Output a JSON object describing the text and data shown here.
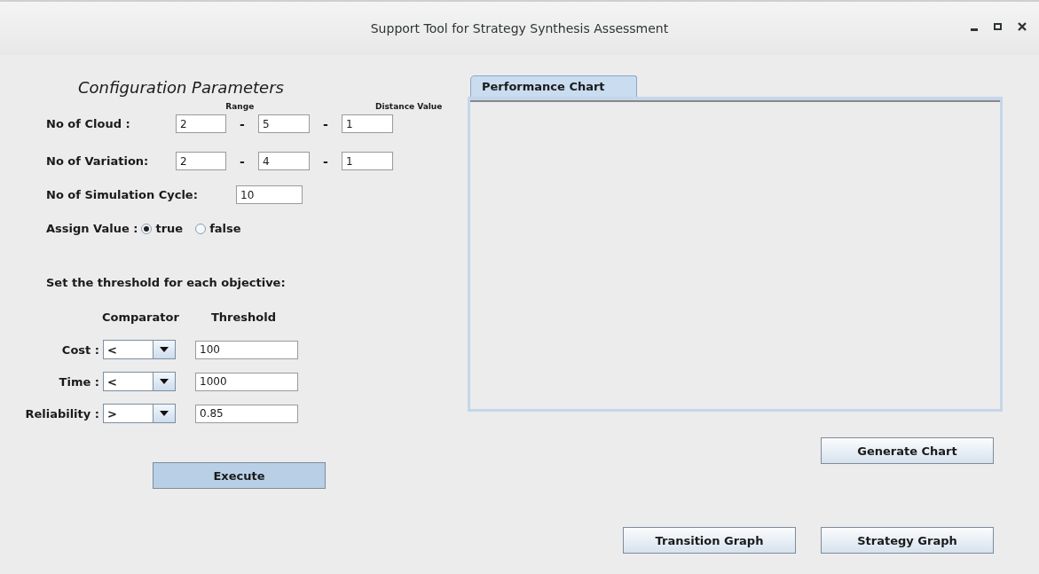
{
  "window": {
    "title": "Support Tool for Strategy Synthesis Assessment"
  },
  "config": {
    "heading": "Configuration Parameters",
    "range_header": "Range",
    "distance_header": "Distance Value",
    "ranges": [
      {
        "label": "No of Cloud :",
        "from": "2",
        "to": "5",
        "step": "1",
        "separators": [
          "-",
          "-"
        ]
      },
      {
        "label": "No of Variation:",
        "from": "2",
        "to": "4",
        "step": "1",
        "separators": [
          "-",
          "-"
        ]
      }
    ],
    "cycles": {
      "label": "No of Simulation Cycle:",
      "value": "10"
    },
    "assign": {
      "label": "Assign Value :",
      "options": [
        {
          "label": "true",
          "selected": true
        },
        {
          "label": "false",
          "selected": false
        }
      ]
    }
  },
  "threshold": {
    "heading": "Set the threshold for each objective:",
    "comparator_header": "Comparator",
    "threshold_header": "Threshold",
    "rows": [
      {
        "label": "Cost :",
        "comparator": "<",
        "value": "100"
      },
      {
        "label": "Time :",
        "comparator": "<",
        "value": "1000"
      },
      {
        "label": "Reliability :",
        "comparator": ">",
        "value": "0.85"
      }
    ]
  },
  "execute_button": "Execute",
  "chart_tab": {
    "label": "Performance Chart",
    "selected": true
  },
  "generate_button": "Generate Chart",
  "bottom_buttons": [
    "Transition Graph",
    "Strategy Graph"
  ]
}
